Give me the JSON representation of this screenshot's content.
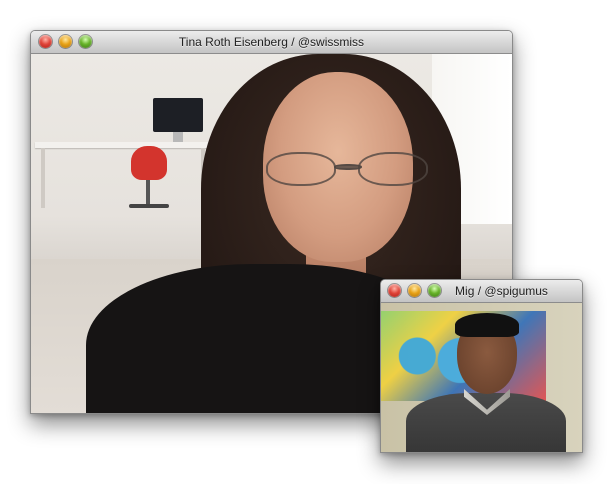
{
  "main_window": {
    "title": "Tina Roth Eisenberg / @swissmiss"
  },
  "pip_window": {
    "title": "Mig / @spigumus"
  },
  "traffic_lights": {
    "close_color": "#e0453a",
    "minimize_color": "#e8a318",
    "zoom_color": "#68b42a"
  }
}
